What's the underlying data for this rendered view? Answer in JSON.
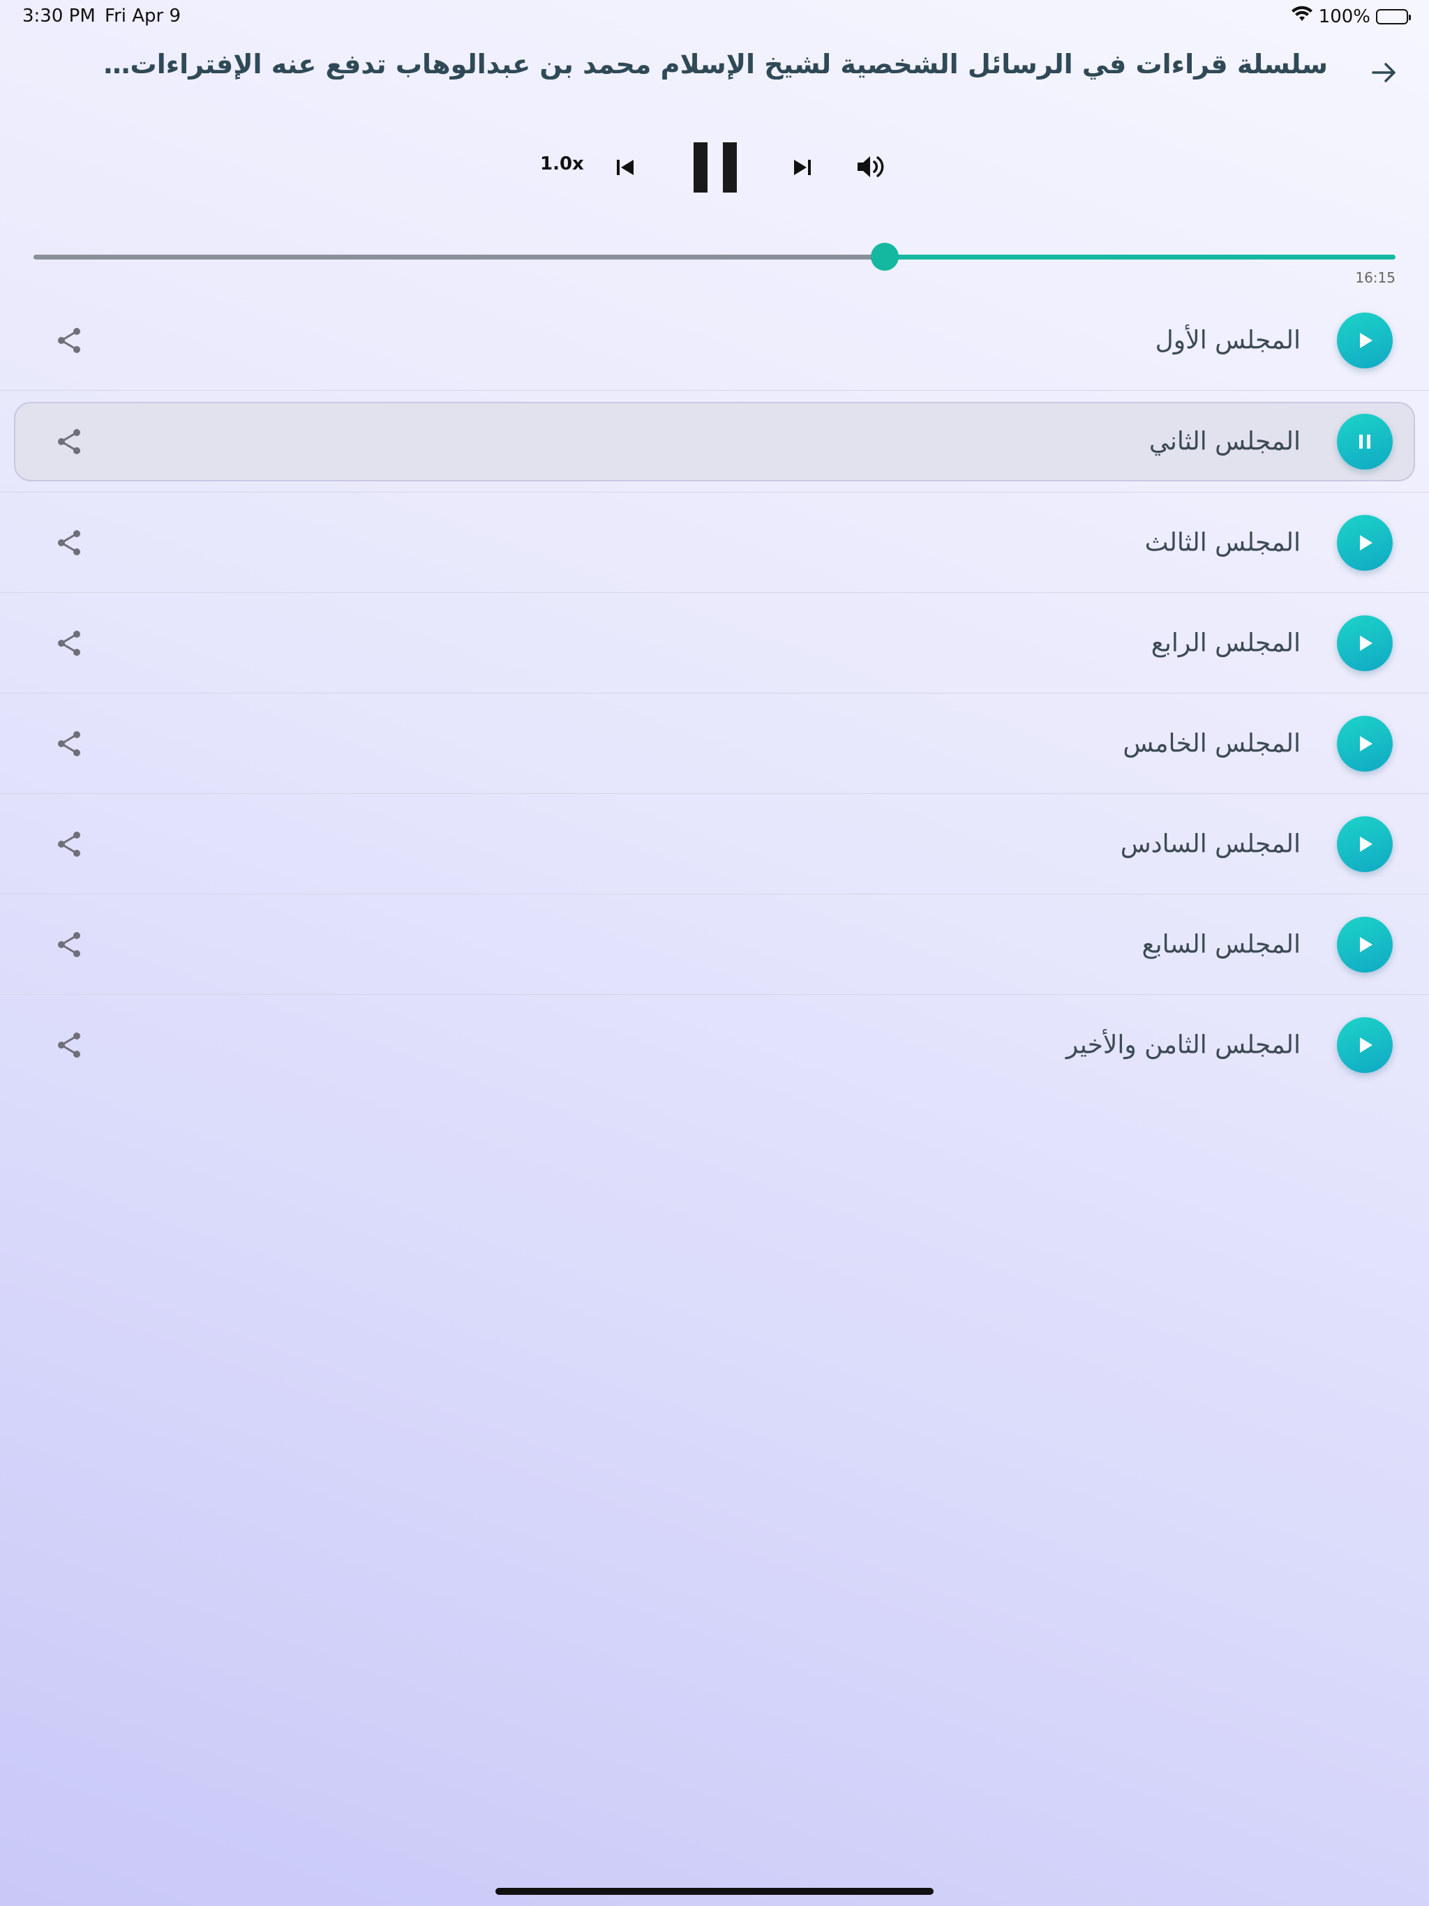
{
  "status": {
    "time": "3:30 PM",
    "date": "Fri Apr 9",
    "battery": "100%"
  },
  "header": {
    "title": "سلسلة قراءات في الرسائل الشخصية لشيخ الإسلام محمد بن عبدالوهاب تدفع عنه الإفتراءات…"
  },
  "player": {
    "speed": "1.0x",
    "progress_fraction": 0.625,
    "duration": "16:15",
    "state": "playing"
  },
  "colors": {
    "accent": "#14b8a0",
    "play_gradient_start": "#1dd3c8",
    "play_gradient_end": "#10a9c4",
    "title": "#2f4a56"
  },
  "tracks": [
    {
      "label": "المجلس الأول",
      "state": "play"
    },
    {
      "label": "المجلس الثاني",
      "state": "pause"
    },
    {
      "label": "المجلس الثالث",
      "state": "play"
    },
    {
      "label": "المجلس الرابع",
      "state": "play"
    },
    {
      "label": "المجلس الخامس",
      "state": "play"
    },
    {
      "label": "المجلس السادس",
      "state": "play"
    },
    {
      "label": "المجلس السابع",
      "state": "play"
    },
    {
      "label": "المجلس الثامن والأخير",
      "state": "play"
    }
  ]
}
